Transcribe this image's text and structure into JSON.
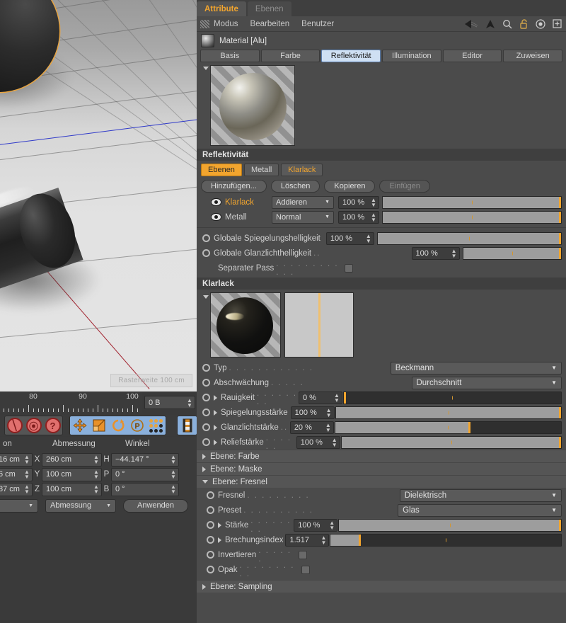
{
  "viewport": {
    "grid_label": "Rasterweite    100 cm",
    "axis_z_color": "#2630c8",
    "axis_x_color": "#9e1724",
    "selection_color": "#e8a33d"
  },
  "ruler": {
    "labels": [
      "80",
      "90",
      "100"
    ]
  },
  "unit_field": {
    "value": "0 B"
  },
  "icon_toolbar": {
    "left_group": [
      {
        "name": "lock-axis-icon",
        "glyph": "╱"
      },
      {
        "name": "rotate-lock-icon",
        "glyph": "○"
      },
      {
        "name": "help-icon",
        "glyph": "?"
      }
    ],
    "mid_group": [
      {
        "name": "move-tool-icon"
      },
      {
        "name": "scale-tool-icon"
      },
      {
        "name": "rotate-tool-icon"
      },
      {
        "name": "parametric-tool-icon",
        "glyph": "P"
      },
      {
        "name": "point-mode-icon"
      }
    ],
    "right_group": [
      {
        "name": "render-view-icon"
      }
    ]
  },
  "coords": {
    "headers": [
      "on",
      "Abmessung",
      "Winkel"
    ],
    "rows": [
      {
        "pos_value": "16 cm",
        "dim_axis": "X",
        "dim_value": "260 cm",
        "ang_axis": "H",
        "ang_value": "−44.147 °"
      },
      {
        "pos_value": "6 cm",
        "dim_axis": "Y",
        "dim_value": "100 cm",
        "ang_axis": "P",
        "ang_value": "0 °"
      },
      {
        "pos_value": "87 cm",
        "dim_axis": "Z",
        "dim_value": "100 cm",
        "ang_axis": "B",
        "ang_value": "0 °"
      }
    ],
    "mode_dropdown": "",
    "size_dropdown": "Abmessung",
    "apply_button": "Anwenden"
  },
  "manager": {
    "tabs": [
      {
        "label": "Attribute",
        "active": true
      },
      {
        "label": "Ebenen",
        "active": false
      }
    ],
    "menus": [
      "Modus",
      "Bearbeiten",
      "Benutzer"
    ],
    "icons": [
      {
        "name": "back-arrow-icon"
      },
      {
        "name": "up-arrow-icon"
      },
      {
        "name": "search-icon"
      },
      {
        "name": "lock-icon"
      },
      {
        "name": "target-icon"
      },
      {
        "name": "add-icon"
      }
    ],
    "object_title": "Material [Alu]",
    "property_tabs": [
      {
        "label": "Basis",
        "active": false
      },
      {
        "label": "Farbe",
        "active": false
      },
      {
        "label": "Reflektivität",
        "active": true
      },
      {
        "label": "Illumination",
        "active": false
      },
      {
        "label": "Editor",
        "active": false
      },
      {
        "label": "Zuweisen",
        "active": false
      }
    ]
  },
  "reflectivity": {
    "section_title": "Reflektivität",
    "layer_tabs": [
      {
        "label": "Ebenen",
        "state": "on"
      },
      {
        "label": "Metall",
        "state": "off"
      },
      {
        "label": "Klarlack",
        "state": "accent"
      }
    ],
    "buttons": [
      {
        "label": "Hinzufügen...",
        "enabled": true
      },
      {
        "label": "Löschen",
        "enabled": true
      },
      {
        "label": "Kopieren",
        "enabled": true
      },
      {
        "label": "Einfügen",
        "enabled": false
      }
    ],
    "layers": [
      {
        "name": "Klarlack",
        "selected": true,
        "mode": "Addieren",
        "amount": "100 %",
        "fill_pct": 100
      },
      {
        "name": "Metall",
        "selected": false,
        "mode": "Normal",
        "amount": "100 %",
        "fill_pct": 100
      }
    ],
    "globals": [
      {
        "label": "Globale Spiegelungshelligkeit",
        "value": "100 %",
        "fill_pct": 100
      },
      {
        "label": "Globale Glanzlichthelligkeit",
        "value": "100 %",
        "fill_pct": 100
      }
    ],
    "separate_pass": {
      "label": "Separater Pass",
      "checked": false
    }
  },
  "klarlack": {
    "section_title": "Klarlack",
    "params": [
      {
        "label": "Typ",
        "kind": "dropdown",
        "value": "Beckmann"
      },
      {
        "label": "Abschwächung",
        "kind": "dropdown",
        "value": "Durchschnitt"
      },
      {
        "label": "Rauigkeit",
        "kind": "slider",
        "value": "0 %",
        "fill_pct": 0
      },
      {
        "label": "Spiegelungsstärke",
        "kind": "slider",
        "value": "100 %",
        "fill_pct": 100
      },
      {
        "label": "Glanzlichtstärke",
        "kind": "slider",
        "value": "20 %",
        "fill_pct": 60
      },
      {
        "label": "Reliefstärke",
        "kind": "slider",
        "value": "100 %",
        "fill_pct": 100
      }
    ]
  },
  "groups": [
    {
      "label": "Ebene: Farbe",
      "expanded": false
    },
    {
      "label": "Ebene: Maske",
      "expanded": false
    },
    {
      "label": "Ebene: Fresnel",
      "expanded": true
    }
  ],
  "fresnel": {
    "params": [
      {
        "label": "Fresnel",
        "kind": "dropdown",
        "value": "Dielektrisch"
      },
      {
        "label": "Preset",
        "kind": "dropdown",
        "value": "Glas"
      },
      {
        "label": "Stärke",
        "kind": "slider",
        "value": "100 %",
        "fill_pct": 100
      },
      {
        "label": "Brechungsindex",
        "kind": "slider",
        "value": "1.517",
        "fill_pct": 13
      },
      {
        "label": "Invertieren",
        "kind": "checkbox",
        "checked": false
      },
      {
        "label": "Opak",
        "kind": "checkbox",
        "checked": false
      }
    ]
  },
  "sampling_group": {
    "label": "Ebene: Sampling",
    "expanded": false
  }
}
